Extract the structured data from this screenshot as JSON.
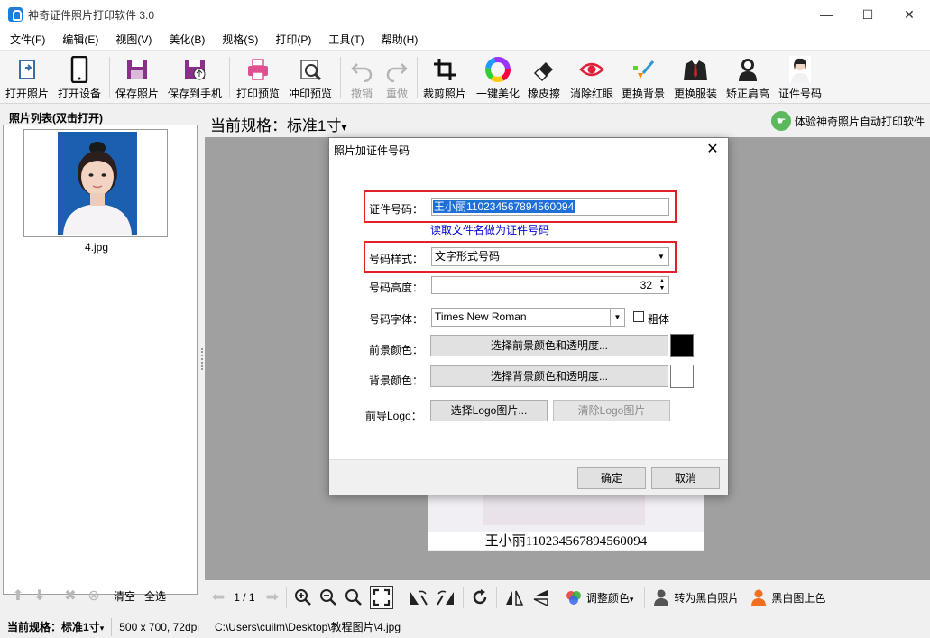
{
  "window": {
    "title": "神奇证件照片打印软件 3.0",
    "controls": {
      "minimize": "—",
      "maximize": "☐",
      "close": "✕"
    }
  },
  "menu": [
    "文件(F)",
    "编辑(E)",
    "视图(V)",
    "美化(B)",
    "规格(S)",
    "打印(P)",
    "工具(T)",
    "帮助(H)"
  ],
  "toolbar": {
    "open_photo": "打开照片",
    "open_device": "打开设备",
    "save_photo": "保存照片",
    "save_to_phone": "保存到手机",
    "print_preview": "打印预览",
    "develop_preview": "冲印预览",
    "undo": "撤销",
    "redo": "重做",
    "crop": "裁剪照片",
    "beautify": "一键美化",
    "eraser": "橡皮擦",
    "red_eye": "消除红眼",
    "change_bg": "更换背景",
    "change_clothes": "更换服装",
    "fix_shoulder": "矫正肩高",
    "id_number": "证件号码"
  },
  "left_panel": {
    "title": "照片列表(双击打开)",
    "photos": [
      {
        "name": "4.jpg"
      }
    ],
    "clear": "清空",
    "select_all": "全选"
  },
  "spec_bar": {
    "current_spec": "当前规格：标准1寸",
    "caret": "▾",
    "promo": "体验神奇照片自动打印软件"
  },
  "canvas": {
    "caption": "王小丽110234567894560094"
  },
  "bottom_bar": {
    "page": "1 / 1",
    "adjust_color": "调整颜色",
    "to_bw": "转为黑白照片",
    "colorize": "黑白图上色"
  },
  "status_bar": {
    "spec": "当前规格：标准1寸",
    "size": "500 x 700, 72dpi",
    "path": "C:\\Users\\cuilm\\Desktop\\教程图片\\4.jpg"
  },
  "dialog": {
    "title": "照片加证件号码",
    "id_label": "证件号码：",
    "id_value": "王小丽110234567894560094",
    "read_filename_link": "读取文件名做为证件号码",
    "style_label": "号码样式：",
    "style_value": "文字形式号码",
    "height_label": "号码高度：",
    "height_value": "32",
    "font_label": "号码字体：",
    "font_value": "Times New Roman",
    "bold_label": "粗体",
    "bold_checked": false,
    "fg_label": "前景颜色：",
    "fg_button": "选择前景颜色和透明度...",
    "fg_color": "#000000",
    "bg_label": "背景颜色：",
    "bg_button": "选择背景颜色和透明度...",
    "bg_color": "#ffffff",
    "logo_label": "前导Logo：",
    "logo_select": "选择Logo图片...",
    "logo_clear": "清除Logo图片",
    "ok": "确定",
    "cancel": "取消"
  },
  "colors": {
    "highlight": "#e0202a",
    "selection": "#1e6fd8",
    "link": "#0000d0",
    "canvas_bg": "#a0a0a0",
    "photo_bg_blue": "#1b5fb0"
  }
}
